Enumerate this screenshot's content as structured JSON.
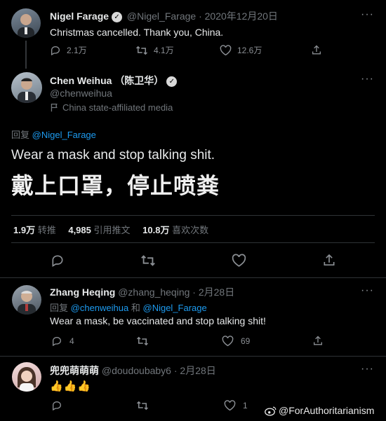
{
  "tweet1": {
    "name": "Nigel Farage",
    "handle": "@Nigel_Farage",
    "date": "· 2020年12月20日",
    "text": "Christmas cancelled. Thank you, China.",
    "replies": "2.1万",
    "retweets": "4.1万",
    "likes": "12.6万"
  },
  "tweet2": {
    "name": "Chen Weihua",
    "name_cn": "（陈卫华）",
    "handle": "@chenweihua",
    "label": "China state-affiliated media",
    "reply_prefix": "回复",
    "reply_to": "@Nigel_Farage",
    "text_en": "Wear a mask and stop talking shit.",
    "text_cn": "戴上口罩，停止喷粪",
    "stats": {
      "retweets_num": "1.9万",
      "retweets_label": "转推",
      "quotes_num": "4,985",
      "quotes_label": "引用推文",
      "likes_num": "10.8万",
      "likes_label": "喜欢次数"
    }
  },
  "tweet3": {
    "name": "Zhang Heqing",
    "handle": "@zhang_heqing",
    "date": "· 2月28日",
    "reply_prefix": "回复",
    "reply_to_1": "@chenweihua",
    "reply_and": "和",
    "reply_to_2": "@Nigel_Farage",
    "text": "Wear a mask, be vaccinated and stop talking shit!",
    "replies": "4",
    "likes": "69"
  },
  "tweet4": {
    "name": "兜兜萌萌萌",
    "handle": "@doudoubaby6",
    "date": "· 2月28日",
    "text": "👍👍👍",
    "likes": "1"
  },
  "watermark": "@ForAuthoritarianism",
  "more_glyph": "···"
}
